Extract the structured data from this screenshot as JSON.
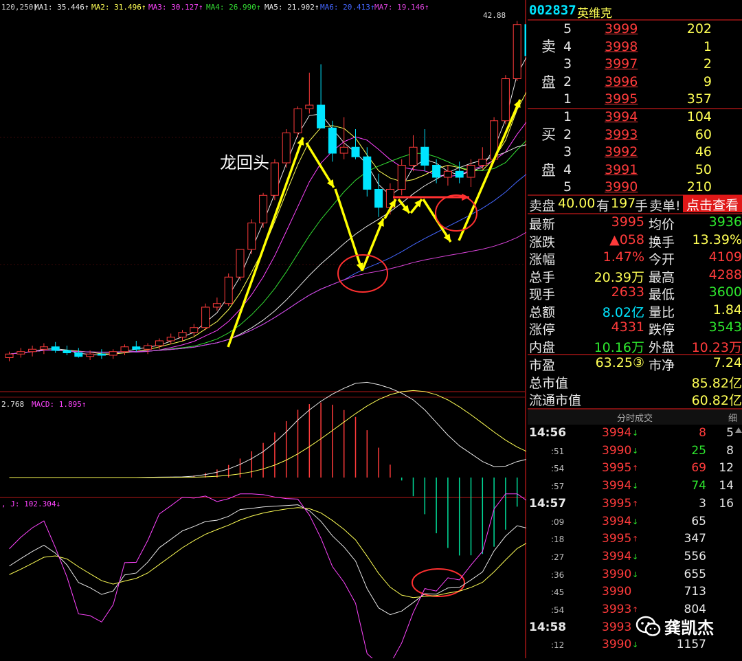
{
  "indicator_header": {
    "params": "120,250)",
    "ma1": "MA1: 35.446↑",
    "ma2": "MA2: 31.496↑",
    "ma3": "MA3: 30.127↑",
    "ma4": "MA4: 26.990↑",
    "ma5": "MA5: 21.902↑",
    "ma6": "MA6: 20.413↑",
    "ma7": "MA7: 19.146↑"
  },
  "price_peak_label": "42.88",
  "annotation_text": "龙回头",
  "macd_header": {
    "dif": "2.768",
    "macd": "MACD: 1.895↑"
  },
  "kdj_header": {
    "j": ", J: 102.304↓"
  },
  "colors": {
    "up": "#ff3b3b",
    "down": "#00e5ff",
    "arrow": "#ffff00",
    "circle": "#ff3030",
    "bg": "#000000"
  },
  "chart_data": {
    "type": "candlestick",
    "candles": [
      {
        "o": 14.9,
        "h": 15.4,
        "l": 14.6,
        "c": 15.2
      },
      {
        "o": 15.2,
        "h": 15.7,
        "l": 14.9,
        "c": 15.4
      },
      {
        "o": 15.4,
        "h": 15.9,
        "l": 15.0,
        "c": 15.6
      },
      {
        "o": 15.6,
        "h": 16.1,
        "l": 15.2,
        "c": 15.8
      },
      {
        "o": 15.8,
        "h": 16.2,
        "l": 15.3,
        "c": 15.5
      },
      {
        "o": 15.5,
        "h": 15.9,
        "l": 15.1,
        "c": 15.3
      },
      {
        "o": 15.3,
        "h": 15.7,
        "l": 14.9,
        "c": 15.0
      },
      {
        "o": 15.0,
        "h": 15.5,
        "l": 14.7,
        "c": 15.2
      },
      {
        "o": 15.2,
        "h": 15.6,
        "l": 14.8,
        "c": 15.1
      },
      {
        "o": 15.1,
        "h": 15.6,
        "l": 14.8,
        "c": 15.4
      },
      {
        "o": 15.4,
        "h": 16.0,
        "l": 15.1,
        "c": 15.8
      },
      {
        "o": 15.8,
        "h": 16.3,
        "l": 15.4,
        "c": 15.6
      },
      {
        "o": 15.6,
        "h": 16.1,
        "l": 15.2,
        "c": 15.9
      },
      {
        "o": 15.9,
        "h": 16.5,
        "l": 15.6,
        "c": 16.3
      },
      {
        "o": 16.3,
        "h": 16.9,
        "l": 16.0,
        "c": 16.6
      },
      {
        "o": 16.6,
        "h": 17.2,
        "l": 16.3,
        "c": 17.0
      },
      {
        "o": 17.0,
        "h": 17.7,
        "l": 16.7,
        "c": 17.4
      },
      {
        "o": 17.4,
        "h": 19.4,
        "l": 17.2,
        "c": 19.1
      },
      {
        "o": 19.1,
        "h": 19.9,
        "l": 18.8,
        "c": 19.4
      },
      {
        "o": 19.4,
        "h": 21.9,
        "l": 19.2,
        "c": 21.6
      },
      {
        "o": 21.6,
        "h": 23.6,
        "l": 21.3,
        "c": 23.9
      },
      {
        "o": 23.9,
        "h": 26.4,
        "l": 23.5,
        "c": 26.1
      },
      {
        "o": 26.1,
        "h": 28.6,
        "l": 25.7,
        "c": 28.4
      },
      {
        "o": 28.4,
        "h": 31.4,
        "l": 28.0,
        "c": 31.1
      },
      {
        "o": 31.1,
        "h": 33.9,
        "l": 30.7,
        "c": 33.6
      },
      {
        "o": 33.6,
        "h": 35.8,
        "l": 33.2,
        "c": 35.6
      },
      {
        "o": 35.6,
        "h": 38.6,
        "l": 35.2,
        "c": 35.9
      },
      {
        "o": 35.9,
        "h": 39.3,
        "l": 35.0,
        "c": 34.0
      },
      {
        "o": 34.0,
        "h": 34.6,
        "l": 31.2,
        "c": 31.9
      },
      {
        "o": 31.9,
        "h": 34.9,
        "l": 31.4,
        "c": 32.4
      },
      {
        "o": 32.4,
        "h": 33.9,
        "l": 31.4,
        "c": 31.6
      },
      {
        "o": 31.6,
        "h": 32.4,
        "l": 28.3,
        "c": 28.9
      },
      {
        "o": 28.9,
        "h": 30.2,
        "l": 26.6,
        "c": 27.4
      },
      {
        "o": 27.4,
        "h": 29.4,
        "l": 26.8,
        "c": 28.9
      },
      {
        "o": 28.9,
        "h": 31.4,
        "l": 28.4,
        "c": 30.9
      },
      {
        "o": 30.9,
        "h": 33.4,
        "l": 30.4,
        "c": 32.4
      },
      {
        "o": 32.4,
        "h": 33.9,
        "l": 30.4,
        "c": 30.9
      },
      {
        "o": 30.9,
        "h": 31.4,
        "l": 29.4,
        "c": 29.9
      },
      {
        "o": 29.9,
        "h": 30.9,
        "l": 29.2,
        "c": 30.4
      },
      {
        "o": 30.4,
        "h": 31.2,
        "l": 29.4,
        "c": 29.9
      },
      {
        "o": 29.9,
        "h": 31.4,
        "l": 29.1,
        "c": 30.9
      },
      {
        "o": 30.9,
        "h": 32.4,
        "l": 30.6,
        "c": 31.4
      },
      {
        "o": 31.4,
        "h": 34.9,
        "l": 31.2,
        "c": 34.6
      },
      {
        "o": 34.6,
        "h": 38.4,
        "l": 34.3,
        "c": 38.1
      },
      {
        "o": 38.1,
        "h": 42.9,
        "l": 37.9,
        "c": 42.6
      },
      {
        "o": 42.6,
        "h": 42.88,
        "l": 38.0,
        "c": 40.0
      }
    ]
  },
  "order_book": {
    "stock_code": "002837",
    "stock_name": "英维克",
    "ask_label_1": "卖",
    "ask_label_2": "盘",
    "bid_label_1": "买",
    "bid_label_2": "盘",
    "asks": [
      {
        "level": "5",
        "price": "3999",
        "volume": "202"
      },
      {
        "level": "4",
        "price": "3998",
        "volume": "1"
      },
      {
        "level": "3",
        "price": "3997",
        "volume": "2"
      },
      {
        "level": "2",
        "price": "3996",
        "volume": "9"
      },
      {
        "level": "1",
        "price": "3995",
        "volume": "357"
      }
    ],
    "bids": [
      {
        "level": "1",
        "price": "3994",
        "volume": "104"
      },
      {
        "level": "2",
        "price": "3993",
        "volume": "60"
      },
      {
        "level": "3",
        "price": "3992",
        "volume": "46"
      },
      {
        "level": "4",
        "price": "3991",
        "volume": "50"
      },
      {
        "level": "5",
        "price": "3990",
        "volume": "210"
      }
    ]
  },
  "summary_bar": {
    "label_ask": "卖盘",
    "ask_value": "40.00",
    "label_have": "有",
    "count": "197",
    "label_hand": "手",
    "label_order": "卖单!",
    "click_button": "点击查看"
  },
  "quote_stats": [
    {
      "l": "最新",
      "v": "3995",
      "vc": "red",
      "l2": "均价",
      "v2": "3936",
      "v2c": "green"
    },
    {
      "l": "涨跌",
      "v": "▲058",
      "vc": "red",
      "l2": "换手",
      "v2": "13.39%",
      "v2c": "yellow"
    },
    {
      "l": "涨幅",
      "v": "1.47%",
      "vc": "red",
      "l2": "今开",
      "v2": "4109",
      "v2c": "red"
    },
    {
      "l": "总手",
      "v": "20.39万",
      "vc": "yellow",
      "l2": "最高",
      "v2": "4288",
      "v2c": "red"
    },
    {
      "l": "现手",
      "v": "2633",
      "vc": "red",
      "l2": "最低",
      "v2": "3600",
      "v2c": "green"
    },
    {
      "l": "总额",
      "v": "8.02亿",
      "vc": "cyan",
      "l2": "量比",
      "v2": "1.84",
      "v2c": "yellow"
    },
    {
      "l": "涨停",
      "v": "4331",
      "vc": "red",
      "l2": "跌停",
      "v2": "3543",
      "v2c": "green"
    },
    {
      "l": "内盘",
      "v": "10.16万",
      "vc": "green",
      "l2": "外盘",
      "v2": "10.23万",
      "v2c": "red"
    }
  ],
  "valuation": [
    {
      "l": "市盈",
      "v": "63.25③",
      "l2": "市净",
      "v2": "7.24"
    },
    {
      "l": "总市值",
      "v": "",
      "l2": "",
      "v2": "85.82亿"
    },
    {
      "l": "流通市值",
      "v": "",
      "l2": "",
      "v2": "60.82亿"
    }
  ],
  "ticker": {
    "title": "分时成交",
    "detail_tab": "细",
    "rows": [
      {
        "t": "14:56",
        "p": "3994",
        "d": "↓",
        "v": "8",
        "vc": "red",
        "n": "5",
        "big": true
      },
      {
        "t": ":51",
        "p": "3990",
        "d": "↓",
        "v": "25",
        "vc": "green",
        "n": "8",
        "big": false
      },
      {
        "t": ":54",
        "p": "3995",
        "d": "↑",
        "v": "69",
        "vc": "red",
        "n": "12",
        "big": false
      },
      {
        "t": ":57",
        "p": "3994",
        "d": "↓",
        "v": "74",
        "vc": "green",
        "n": "14",
        "big": false
      },
      {
        "t": "14:57",
        "p": "3995",
        "d": "↑",
        "v": "3",
        "vc": "white",
        "n": "16",
        "big": true
      },
      {
        "t": ":09",
        "p": "3994",
        "d": "↓",
        "v": "65",
        "vc": "white",
        "n": "",
        "big": false
      },
      {
        "t": ":18",
        "p": "3995",
        "d": "↑",
        "v": "347",
        "vc": "white",
        "n": "",
        "big": false
      },
      {
        "t": ":27",
        "p": "3994",
        "d": "↓",
        "v": "556",
        "vc": "white",
        "n": "",
        "big": false
      },
      {
        "t": ":36",
        "p": "3990",
        "d": "↓",
        "v": "655",
        "vc": "white",
        "n": "",
        "big": false
      },
      {
        "t": ":45",
        "p": "3990",
        "d": "",
        "v": "713",
        "vc": "white",
        "n": "",
        "big": false
      },
      {
        "t": ":54",
        "p": "3993",
        "d": "↑",
        "v": "804",
        "vc": "white",
        "n": "",
        "big": false
      },
      {
        "t": "14:58",
        "p": "3993",
        "d": "",
        "v": "",
        "vc": "white",
        "n": "",
        "big": true
      },
      {
        "t": ":12",
        "p": "3990",
        "d": "↓",
        "v": "1157",
        "vc": "white",
        "n": "",
        "big": false
      }
    ]
  },
  "watermark": "龚凯杰"
}
